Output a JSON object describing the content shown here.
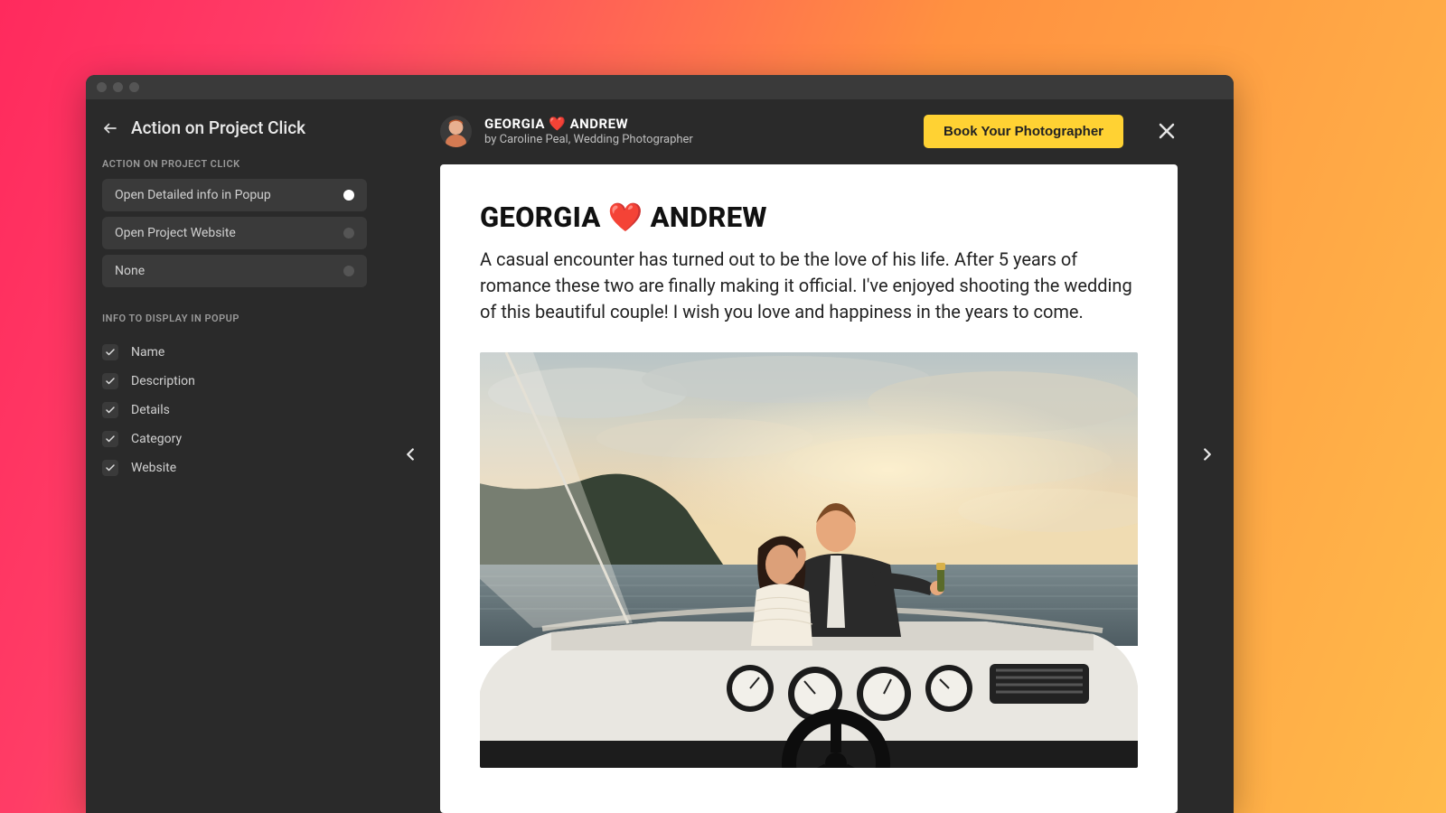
{
  "sidebar": {
    "title": "Action on Project Click",
    "section1_label": "ACTION ON PROJECT CLICK",
    "radios": [
      {
        "label": "Open Detailed info in Popup",
        "selected": true
      },
      {
        "label": "Open Project Website",
        "selected": false
      },
      {
        "label": "None",
        "selected": false
      }
    ],
    "section2_label": "INFO TO DISPLAY IN POPUP",
    "checks": [
      {
        "label": "Name",
        "checked": true
      },
      {
        "label": "Description",
        "checked": true
      },
      {
        "label": "Details",
        "checked": true
      },
      {
        "label": "Category",
        "checked": true
      },
      {
        "label": "Website",
        "checked": true
      }
    ]
  },
  "popup": {
    "header_title": "GEORGIA ❤️  ANDREW",
    "header_sub": "by Caroline Peal, Wedding Photographer",
    "cta_label": "Book Your Photographer",
    "card_title": "GEORGIA ❤️ ANDREW",
    "card_desc": "A casual encounter has turned out to be the love of his life. After 5 years of romance these two are finally making it official. I've enjoyed shooting the wedding of this beautiful couple! I wish you love and happiness in the years to come."
  },
  "colors": {
    "accent": "#ffd233"
  }
}
